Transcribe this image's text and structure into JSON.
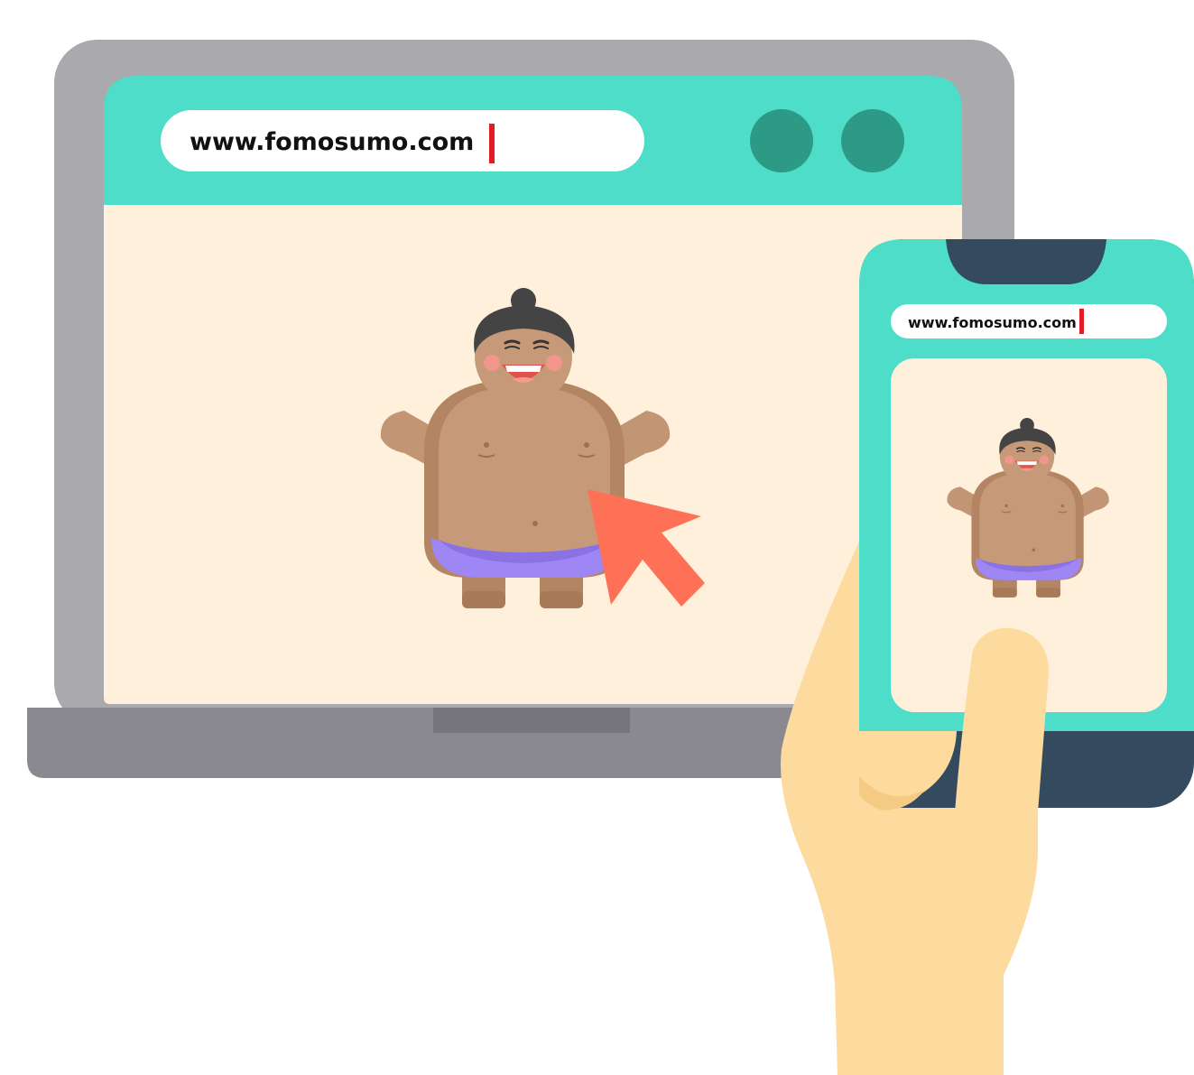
{
  "laptop": {
    "address_bar": {
      "url": "www.fomosumo.com"
    },
    "window_buttons": [
      {
        "name": "window-button-1"
      },
      {
        "name": "window-button-2"
      }
    ]
  },
  "phone": {
    "address_bar": {
      "url": "www.fomosumo.com"
    }
  },
  "colors": {
    "laptop_frame": "#AAA9AE",
    "laptop_base": "#8A8990",
    "laptop_hinge": "#76757C",
    "browser_header": "#4EDDC8",
    "browser_content": "#FFF0DC",
    "window_button": "#2C9A85",
    "text_cursor": "#E01C24",
    "phone_body": "#344A5E",
    "phone_screen": "#4EDDC8",
    "skin_sumo": "#C69A79",
    "belt": "#9F86F5",
    "hair": "#444444",
    "pointer_cursor": "#FF7157",
    "hand": "#FDDA9D"
  },
  "icons": {
    "pointer": "mouse-pointer-icon",
    "sumo": "sumo-wrestler-illustration",
    "hand": "hand-illustration"
  }
}
